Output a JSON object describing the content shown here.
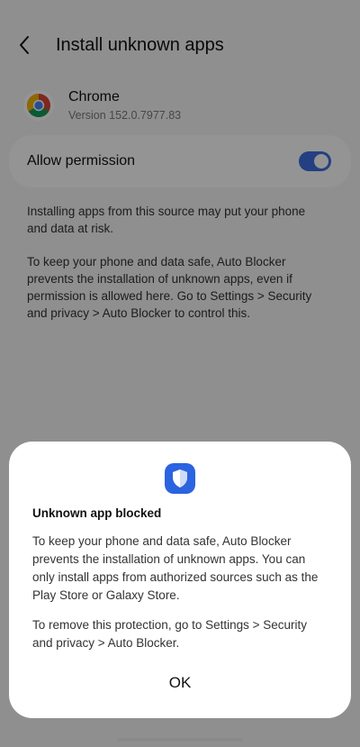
{
  "header": {
    "title": "Install unknown apps",
    "back_icon": "chevron-left-icon"
  },
  "app": {
    "name": "Chrome",
    "version": "Version 152.0.7977.83",
    "icon": "chrome-icon"
  },
  "permission": {
    "label": "Allow permission",
    "enabled": true,
    "accent": "#3e6fe0"
  },
  "description": {
    "p1": "Installing apps from this source may put your phone and data at risk.",
    "p2": "To keep your phone and data safe, Auto Blocker prevents the installation of unknown apps, even if permission is allowed here. Go to Settings > Security and privacy > Auto Blocker to control this."
  },
  "dialog": {
    "icon": "shield-icon",
    "title": "Unknown app blocked",
    "body1": "To keep your phone and data safe, Auto Blocker prevents the installation of unknown apps. You can only install apps from authorized sources such as the Play Store or Galaxy Store.",
    "body2": "To remove this protection, go to Settings > Security and privacy > Auto Blocker.",
    "ok_label": "OK",
    "accent": "#2b63e0"
  }
}
